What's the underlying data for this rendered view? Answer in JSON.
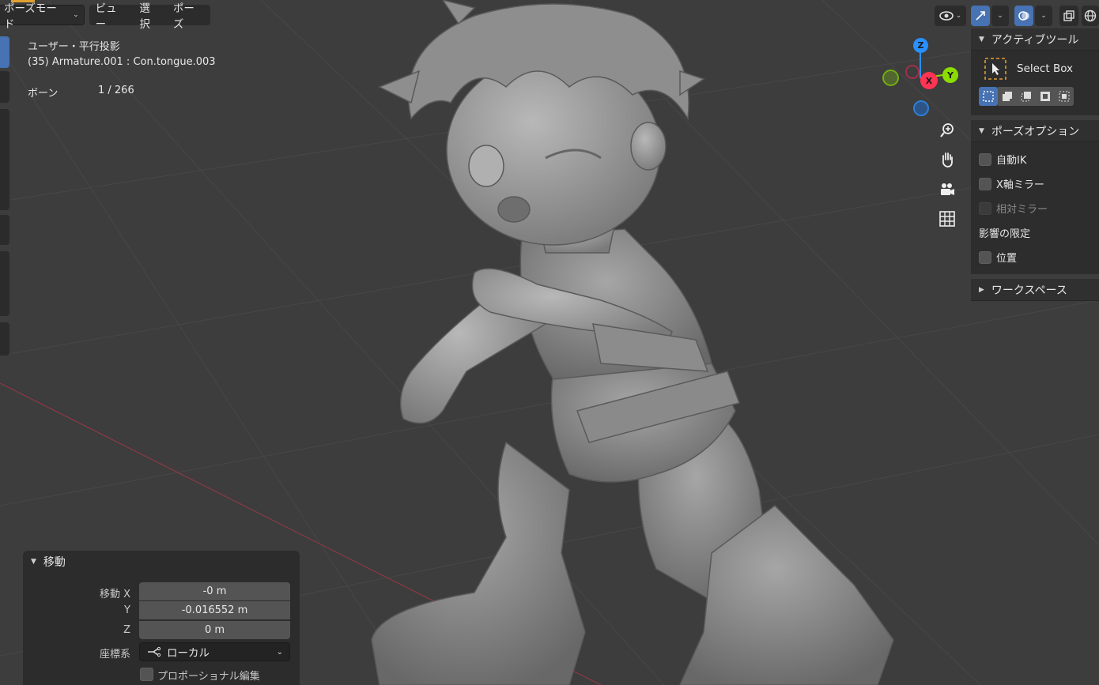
{
  "header": {
    "mode_label": "ポーズモード",
    "menus": [
      "ビュー",
      "選択",
      "ポーズ"
    ]
  },
  "overlay": {
    "view_name": "ユーザー・平行投影",
    "object_info": "(35) Armature.001 : Con.tongue.003",
    "bones_label": "ボーン",
    "bones_count": "1 / 266"
  },
  "gizmo": {
    "z": "Z",
    "y": "Y",
    "x": "X"
  },
  "sidebar": {
    "active_tool": {
      "title": "アクティブツール",
      "tool_name": "Select Box"
    },
    "pose_options": {
      "title": "ポーズオプション",
      "auto_ik": "自動IK",
      "x_mirror": "X軸ミラー",
      "relative_mirror": "相対ミラー",
      "affect_only": "影響の限定",
      "location": "位置"
    },
    "workspace": {
      "title": "ワークスペース"
    }
  },
  "operator": {
    "title": "移動",
    "x_label": "移動 X",
    "x_value": "-0 m",
    "y_label": "Y",
    "y_value": "-0.016552 m",
    "z_label": "Z",
    "z_value": "0 m",
    "orient_label": "座標系",
    "orient_value": "ローカル",
    "proportional_label": "プロポーショナル編集"
  },
  "colors": {
    "viewport_bg": "#3d3d3d",
    "panel_bg": "#2d2d2d",
    "accent_blue": "#4772b3",
    "axis_x": "#ff3352",
    "axis_y": "#8bdc00",
    "axis_z": "#2890ff"
  }
}
